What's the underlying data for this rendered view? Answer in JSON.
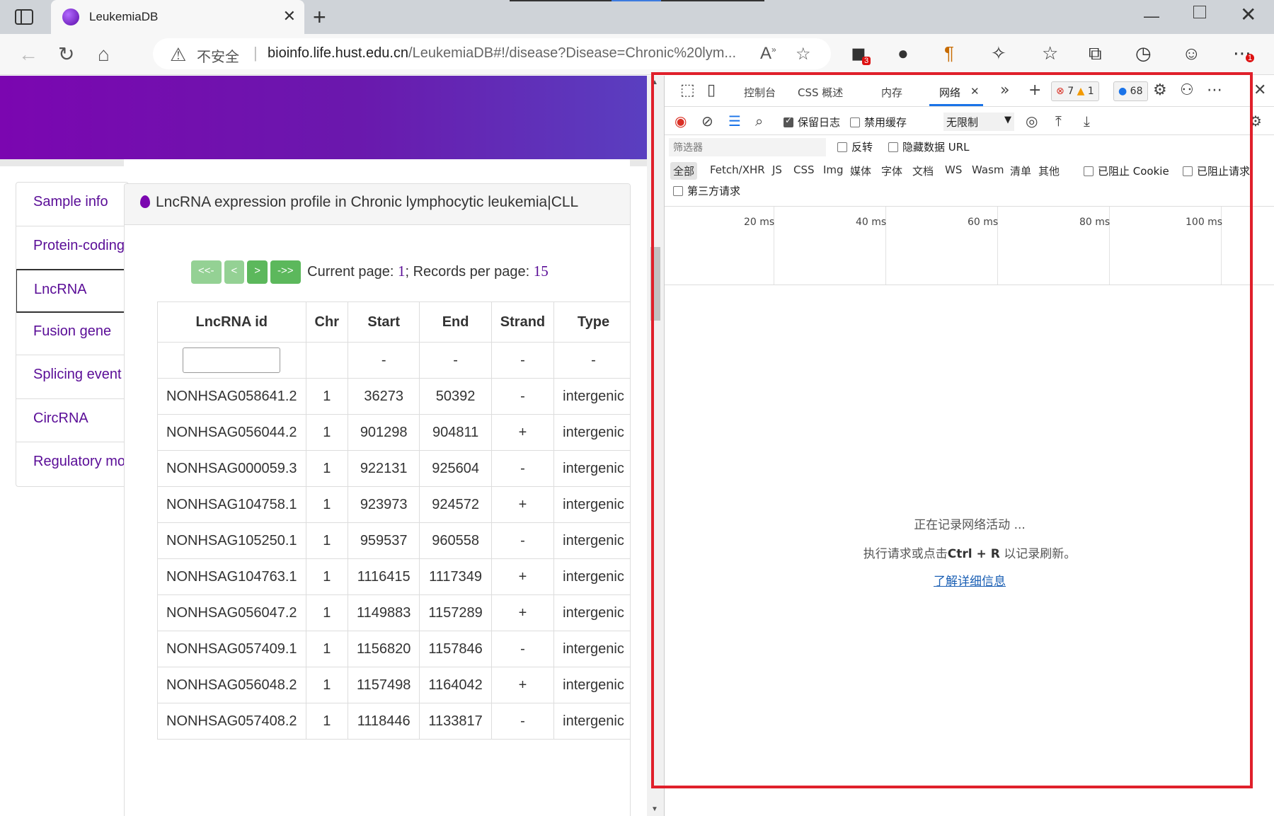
{
  "browser": {
    "tab_title": "LeukemiaDB",
    "tab_close": "✕",
    "new_tab": "+",
    "window_min": "—",
    "window_close": "✕",
    "insecure_label": "不安全",
    "url_host": "bioinfo.life.hust.edu.cn",
    "url_path": "/LeukemiaDB#!/disease?Disease=Chronic%20lym...",
    "extension_badge": "3",
    "menu_badge": "1"
  },
  "sidebar": {
    "items": [
      {
        "label": "Sample info"
      },
      {
        "label": "Protein-coding"
      },
      {
        "label": "LncRNA"
      },
      {
        "label": "Fusion gene"
      },
      {
        "label": "Splicing event"
      },
      {
        "label": "CircRNA"
      },
      {
        "label": "Regulatory mo"
      }
    ]
  },
  "panel": {
    "title": "LncRNA expression profile in Chronic lymphocytic leukemia|CLL",
    "pager": {
      "first": "<<-",
      "prev": "<",
      "next": ">",
      "last": "->>",
      "current_page_label": "Current page:",
      "current_page": "1",
      "records_label": "; Records per page:",
      "records_per_page": "15"
    },
    "table": {
      "headers": [
        "LncRNA id",
        "Chr",
        "Start",
        "End",
        "Strand",
        "Type"
      ],
      "filter_row": [
        "",
        "",
        "-",
        "-",
        "-",
        "-"
      ],
      "rows": [
        [
          "NONHSAG058641.2",
          "1",
          "36273",
          "50392",
          "-",
          "intergenic"
        ],
        [
          "NONHSAG056044.2",
          "1",
          "901298",
          "904811",
          "+",
          "intergenic"
        ],
        [
          "NONHSAG000059.3",
          "1",
          "922131",
          "925604",
          "-",
          "intergenic"
        ],
        [
          "NONHSAG104758.1",
          "1",
          "923973",
          "924572",
          "+",
          "intergenic"
        ],
        [
          "NONHSAG105250.1",
          "1",
          "959537",
          "960558",
          "-",
          "intergenic"
        ],
        [
          "NONHSAG104763.1",
          "1",
          "1116415",
          "1117349",
          "+",
          "intergenic"
        ],
        [
          "NONHSAG056047.2",
          "1",
          "1149883",
          "1157289",
          "+",
          "intergenic"
        ],
        [
          "NONHSAG057409.1",
          "1",
          "1156820",
          "1157846",
          "-",
          "intergenic"
        ],
        [
          "NONHSAG056048.2",
          "1",
          "1157498",
          "1164042",
          "+",
          "intergenic"
        ],
        [
          "NONHSAG057408.2",
          "1",
          "1118446",
          "1133817",
          "-",
          "intergenic"
        ]
      ]
    }
  },
  "devtools": {
    "tabs": [
      {
        "label": "控制台"
      },
      {
        "label": "CSS 概述"
      },
      {
        "label": "内存"
      },
      {
        "label": "网络"
      }
    ],
    "errors": "7",
    "warnings": "1",
    "messages": "68",
    "toolbar": {
      "preserve_log": "保留日志",
      "disable_cache": "禁用缓存",
      "throttle": "无限制"
    },
    "filter_placeholder": "筛选器",
    "invert": "反转",
    "hide_data_urls": "隐藏数据 URL",
    "types": [
      "全部",
      "Fetch/XHR",
      "JS",
      "CSS",
      "Img",
      "媒体",
      "字体",
      "文档",
      "WS",
      "Wasm",
      "清单",
      "其他"
    ],
    "blocked_cookies": "已阻止 Cookie",
    "blocked_requests": "已阻止请求",
    "third_party": "第三方请求",
    "timeline_ticks": [
      "20 ms",
      "40 ms",
      "60 ms",
      "80 ms",
      "100 ms"
    ],
    "empty": {
      "line1": "正在记录网络活动 ...",
      "line2_prefix": "执行请求或点击",
      "line2_keys": "Ctrl + R",
      "line2_suffix": " 以记录刷新。",
      "link": "了解详细信息"
    }
  },
  "colors": {
    "banner_start": "#7b06b0",
    "banner_end": "#5a3fc0",
    "link_purple": "#5a0d97",
    "pager_green": "#5cb85c",
    "highlight_red": "#e0202b",
    "devtools_blue": "#1a73e8"
  },
  "icons": {
    "sidebar_toggle": "sidebar-toggle-icon",
    "back": "back-arrow-icon",
    "refresh": "refresh-icon",
    "home": "home-icon",
    "warning": "warning-icon",
    "read_aloud": "read-aloud-icon",
    "favorite_add": "star-plus-icon",
    "record": "record-icon",
    "clear": "clear-icon",
    "filter": "filter-icon",
    "search": "search-icon"
  }
}
